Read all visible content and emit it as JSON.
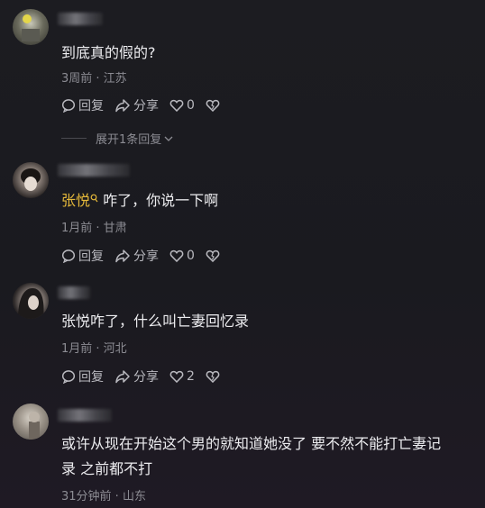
{
  "comments": [
    {
      "text": "到底真的假的?",
      "meta": "3周前 · 江苏",
      "reply": "回复",
      "share": "分享",
      "likes": "0"
    },
    {
      "mention": "张悦",
      "text": "咋了，你说一下啊",
      "meta": "1月前 · 甘肃",
      "reply": "回复",
      "share": "分享",
      "likes": "0"
    },
    {
      "text": "张悦咋了，什么叫亡妻回忆录",
      "meta": "1月前 · 河北",
      "reply": "回复",
      "share": "分享",
      "likes": "2"
    },
    {
      "text_line1": "或许从现在开始这个男的就知道她没了 要不然不能打亡妻记",
      "text_line2": "录  之前都不打",
      "meta": "31分钟前 · 山东"
    }
  ],
  "expand_replies": "展开1条回复"
}
